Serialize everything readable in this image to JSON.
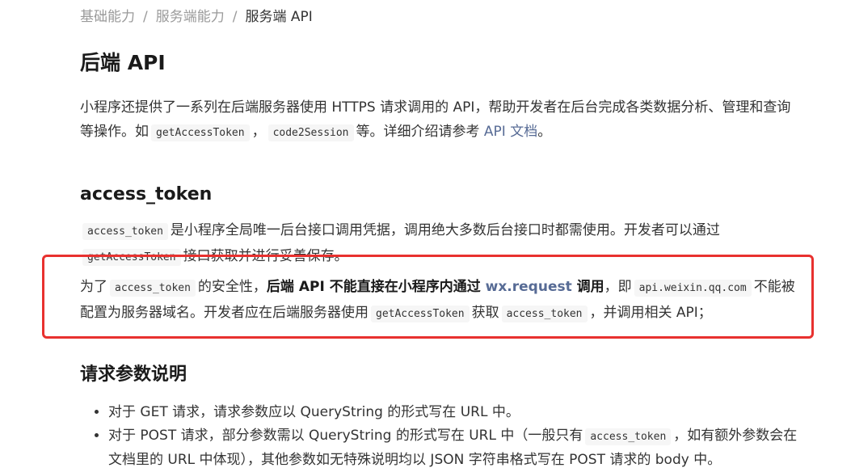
{
  "breadcrumb": {
    "items": [
      "基础能力",
      "服务端能力"
    ],
    "separator": "/",
    "current": "服务端 API"
  },
  "title": "后端 API",
  "intro": {
    "text1": "小程序还提供了一系列在后端服务器使用 HTTPS 请求调用的 API，帮助开发者在后台完成各类数据分析、管理和查询等操作。如",
    "code1": "getAccessToken",
    "sep1": "，",
    "code2": "code2Session",
    "text2": "等。详细介绍请参考",
    "link": "API 文档",
    "end": "。"
  },
  "access_token_section": {
    "heading": "access_token",
    "p1": {
      "code1": "access_token",
      "text1": "是小程序全局唯一后台接口调用凭据，调用绝大多数后台接口时都需使用。开发者可以通过",
      "code2": "getAccessToken",
      "text2": "接口获取并进行妥善保存。"
    },
    "p2": {
      "text1": "为了",
      "code1": "access_token",
      "text2": "的安全性，",
      "bold1": "后端 API 不能直接在小程序内通过",
      "bold_link": "wx.request",
      "bold2": "调用",
      "text3": "，即",
      "code2": "api.weixin.qq.com",
      "text4": "不能被配置为服务器域名。开发者应在后端服务器使用",
      "code3": "getAccessToken",
      "text5": "获取",
      "code4": "access_token",
      "text6": "，并调用相关 API；"
    }
  },
  "params_section": {
    "heading": "请求参数说明",
    "item1": "对于 GET 请求，请求参数应以 QueryString 的形式写在 URL 中。",
    "item2": {
      "text1": "对于 POST 请求，部分参数需以 QueryString 的形式写在 URL 中（一般只有",
      "code1": "access_token",
      "text2": "，如有额外参数会在文档里的 URL 中体现），其他参数如无特殊说明均以 JSON 字符串格式写在 POST 请求的 body 中。"
    }
  },
  "colors": {
    "highlight_border": "#e8312f",
    "link": "#576b95",
    "code_bg": "#f6f6f6"
  }
}
